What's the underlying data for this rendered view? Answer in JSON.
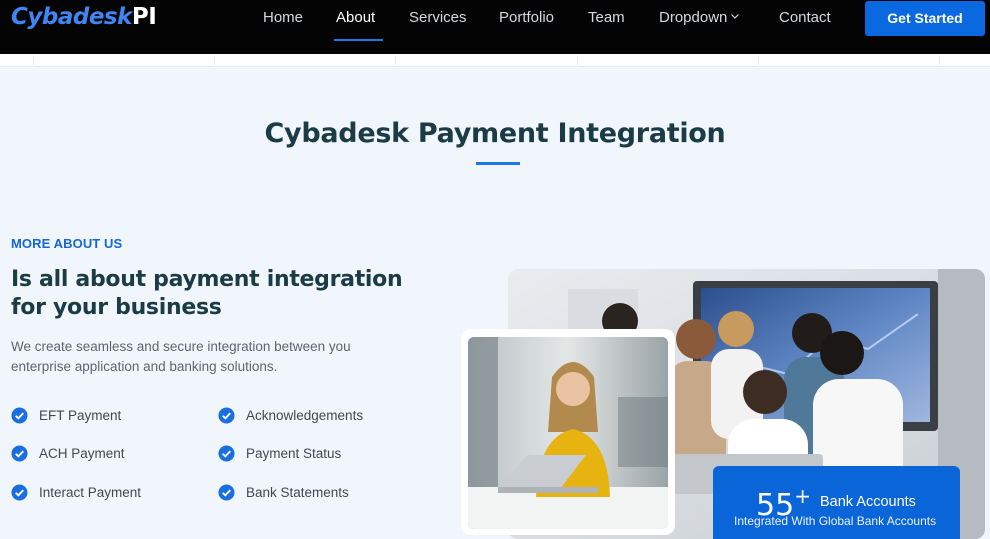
{
  "brand": {
    "part1": "Cybadesk",
    "part2": "PI"
  },
  "nav": {
    "items": [
      "Home",
      "About",
      "Services",
      "Portfolio",
      "Team",
      "Dropdown",
      "Contact"
    ],
    "active": "About",
    "cta": "Get Started"
  },
  "section": {
    "title": "Cybadesk Payment Integration"
  },
  "about": {
    "eyebrow": "MORE ABOUT US",
    "headline": "Is all about payment integration for your business",
    "description": "We create seamless and secure integration between you enterprise application and banking solutions.",
    "features_left": [
      "EFT Payment",
      "ACH Payment",
      "Interact Payment"
    ],
    "features_right": [
      "Acknowledgements",
      "Payment Status",
      "Bank Statements"
    ]
  },
  "stat": {
    "number": "55",
    "plus": "+",
    "label": "Bank Accounts",
    "sublabel": "Integrated With Global Bank Accounts"
  },
  "colors": {
    "accent": "#0a68e0",
    "heading": "#1b3b45",
    "header_bg": "#040404"
  },
  "icons": {
    "check": "check-circle-icon",
    "dropdown": "chevron-down-icon"
  }
}
